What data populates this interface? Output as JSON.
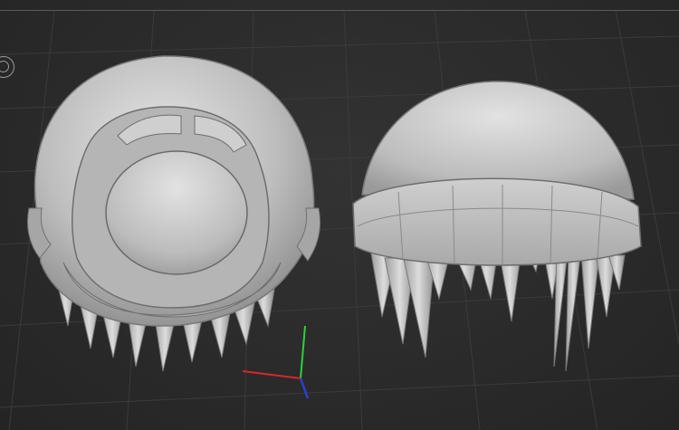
{
  "viewport": {
    "background": "#2b2b2b",
    "grid_color": "#3d3d3d",
    "model_color": "#c9c9c9"
  },
  "objects": [
    {
      "name": "hair-cap-bottom-view",
      "view": "bottom"
    },
    {
      "name": "beanie-hair-front-view",
      "view": "front"
    }
  ],
  "axis_gizmo": {
    "x_color": "#d9262a",
    "y_color": "#2fd13a",
    "z_color": "#2b3fd6"
  },
  "icons": {
    "navigation": "orbit-ring-icon"
  }
}
